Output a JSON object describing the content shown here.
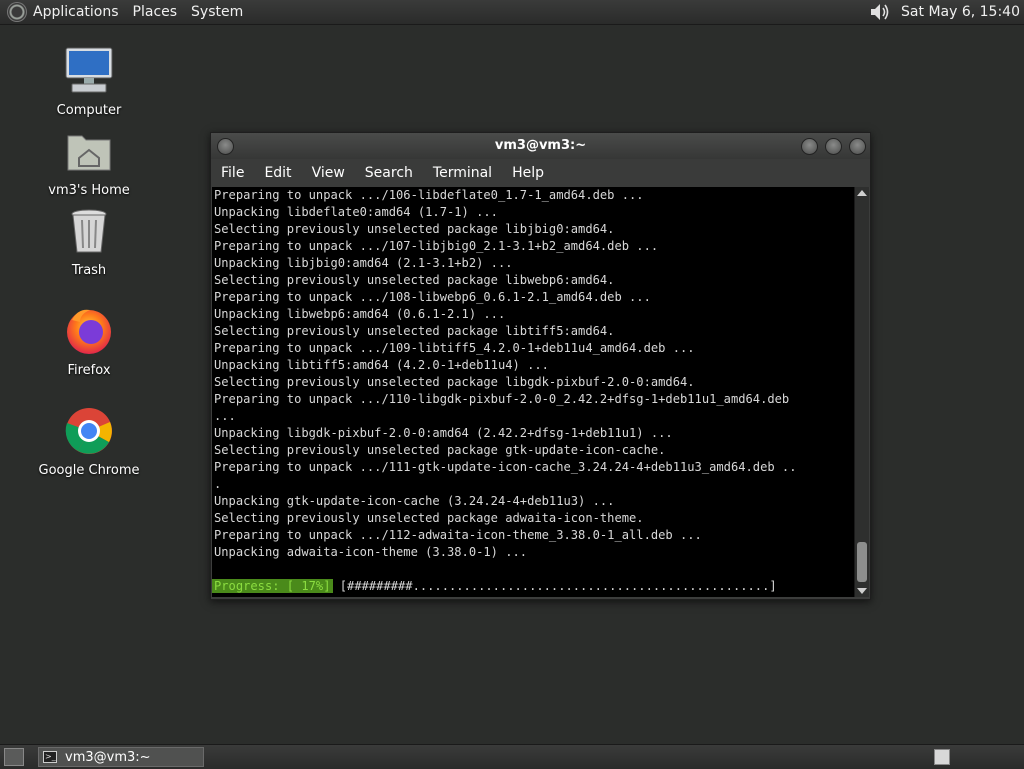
{
  "top_panel": {
    "menus": [
      "Applications",
      "Places",
      "System"
    ],
    "clock": "Sat May  6, 15:40"
  },
  "desktop": {
    "icons": [
      {
        "label": "Computer",
        "icon": "computer-icon"
      },
      {
        "label": "vm3's Home",
        "icon": "home-folder-icon"
      },
      {
        "label": "Trash",
        "icon": "trash-icon"
      },
      {
        "label": "Firefox",
        "icon": "firefox-icon"
      },
      {
        "label": "Google Chrome",
        "icon": "chrome-icon"
      }
    ]
  },
  "terminal": {
    "title": "vm3@vm3:~",
    "menu": [
      "File",
      "Edit",
      "View",
      "Search",
      "Terminal",
      "Help"
    ],
    "lines": [
      "Preparing to unpack .../106-libdeflate0_1.7-1_amd64.deb ...",
      "Unpacking libdeflate0:amd64 (1.7-1) ...",
      "Selecting previously unselected package libjbig0:amd64.",
      "Preparing to unpack .../107-libjbig0_2.1-3.1+b2_amd64.deb ...",
      "Unpacking libjbig0:amd64 (2.1-3.1+b2) ...",
      "Selecting previously unselected package libwebp6:amd64.",
      "Preparing to unpack .../108-libwebp6_0.6.1-2.1_amd64.deb ...",
      "Unpacking libwebp6:amd64 (0.6.1-2.1) ...",
      "Selecting previously unselected package libtiff5:amd64.",
      "Preparing to unpack .../109-libtiff5_4.2.0-1+deb11u4_amd64.deb ...",
      "Unpacking libtiff5:amd64 (4.2.0-1+deb11u4) ...",
      "Selecting previously unselected package libgdk-pixbuf-2.0-0:amd64.",
      "Preparing to unpack .../110-libgdk-pixbuf-2.0-0_2.42.2+dfsg-1+deb11u1_amd64.deb",
      "...",
      "Unpacking libgdk-pixbuf-2.0-0:amd64 (2.42.2+dfsg-1+deb11u1) ...",
      "Selecting previously unselected package gtk-update-icon-cache.",
      "Preparing to unpack .../111-gtk-update-icon-cache_3.24.24-4+deb11u3_amd64.deb ..",
      ".",
      "Unpacking gtk-update-icon-cache (3.24.24-4+deb11u3) ...",
      "Selecting previously unselected package adwaita-icon-theme.",
      "Preparing to unpack .../112-adwaita-icon-theme_3.38.0-1_all.deb ...",
      "Unpacking adwaita-icon-theme (3.38.0-1) ..."
    ],
    "progress_label": "Progress: [ 17%]",
    "progress_percent": 17,
    "progress_bar": "[#########.................................................]"
  },
  "bottom_panel": {
    "task_title": "vm3@vm3:~"
  }
}
